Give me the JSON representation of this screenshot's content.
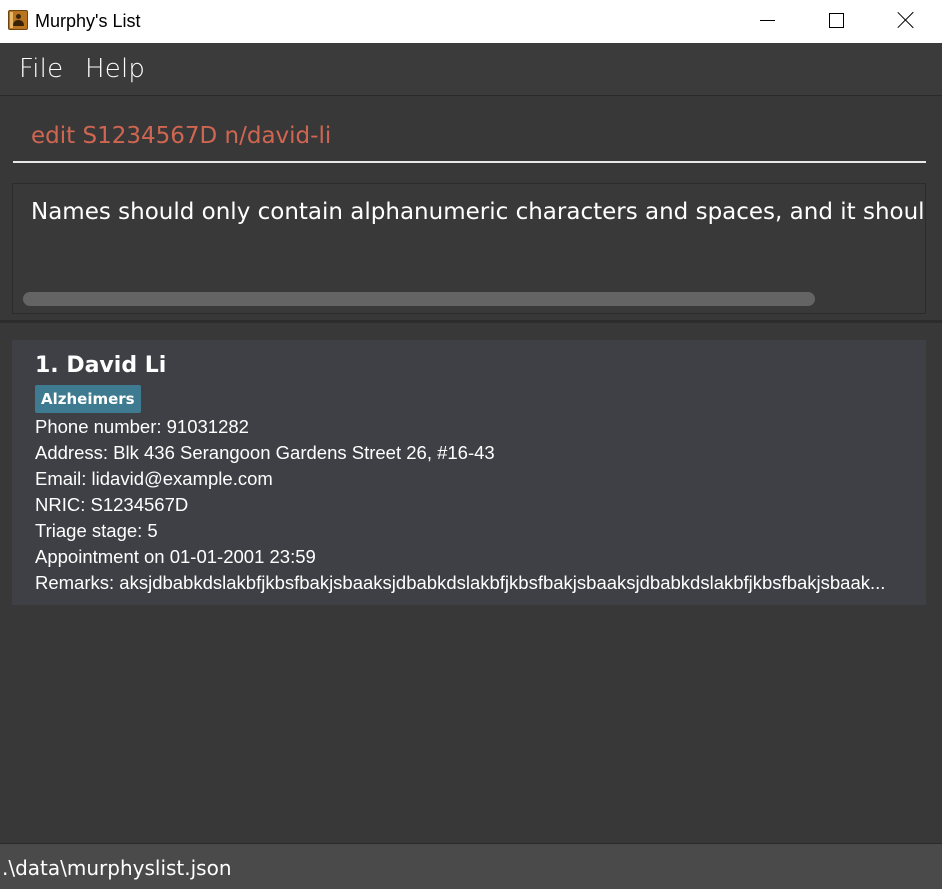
{
  "window": {
    "title": "Murphy's List",
    "icon": "contact-book-icon"
  },
  "menu": {
    "items": [
      {
        "label": "File"
      },
      {
        "label": "Help"
      }
    ]
  },
  "command": {
    "value": "edit S1234567D n/david-li"
  },
  "result": {
    "message": "Names should only contain alphanumeric characters and spaces, and it should not"
  },
  "person_list": [
    {
      "index_name": "1. David Li",
      "tags": [
        "Alzheimers"
      ],
      "phone": "Phone number: 91031282",
      "address": "Address: Blk 436 Serangoon Gardens Street 26, #16-43",
      "email": "Email: lidavid@example.com",
      "nric": "NRIC: S1234567D",
      "triage": "Triage stage: 5",
      "appointment": "Appointment on 01-01-2001 23:59",
      "remarks": "Remarks: aksjdbabkdslakbfjkbsfbakjsbaaksjdbabkdslakbfjkbsfbakjsbaaksjdbabkdslakbfjkbsfbakjsbaak..."
    }
  ],
  "status": {
    "path": ".\\data\\murphyslist.json"
  },
  "colors": {
    "command_text": "#d06651",
    "tag_bg": "#3e7b91",
    "card_bg": "#3e4045",
    "app_bg": "#383838"
  }
}
